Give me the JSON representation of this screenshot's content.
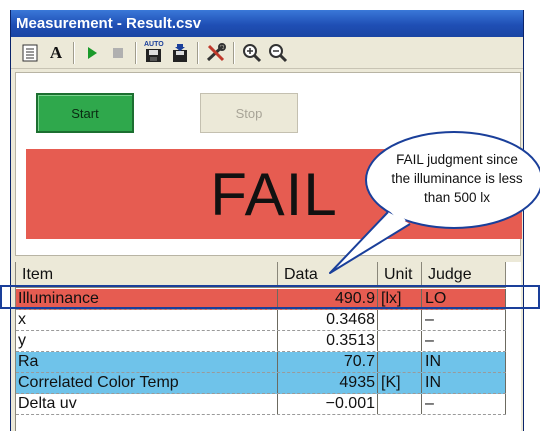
{
  "window": {
    "title": "Measurement - Result.csv"
  },
  "toolbar": {
    "icons": [
      "document-list-icon",
      "font-icon",
      "play-icon",
      "stop-square-icon",
      "auto-save-icon",
      "save-download-icon",
      "tools-icon",
      "zoom-in-icon",
      "zoom-out-icon"
    ],
    "font_glyph": "A",
    "auto_glyph": "AUTO"
  },
  "controls": {
    "start_label": "Start",
    "stop_label": "Stop"
  },
  "result": {
    "judgment": "FAIL",
    "color": "#e65c51"
  },
  "table": {
    "headers": [
      "Item",
      "Data",
      "Unit",
      "Judge"
    ],
    "rows": [
      {
        "item": "Illuminance",
        "data": "490.9",
        "unit": "[lx]",
        "judge": "LO",
        "color": "#e65c51"
      },
      {
        "item": "x",
        "data": "0.3468",
        "unit": "",
        "judge": "–",
        "color": "#ffffff"
      },
      {
        "item": "y",
        "data": "0.3513",
        "unit": "",
        "judge": "–",
        "color": "#ffffff"
      },
      {
        "item": "Ra",
        "data": "70.7",
        "unit": "",
        "judge": "IN",
        "color": "#6fc3ea"
      },
      {
        "item": "Correlated Color Temp",
        "data": "4935",
        "unit": "[K]",
        "judge": "IN",
        "color": "#6fc3ea"
      },
      {
        "item": "Delta uv",
        "data": "−0.001",
        "unit": "",
        "judge": "–",
        "color": "#ffffff"
      }
    ]
  },
  "annotation": {
    "callout_lines": [
      "FAIL judgment since",
      "the illuminance is less",
      "than 500 lx"
    ]
  }
}
